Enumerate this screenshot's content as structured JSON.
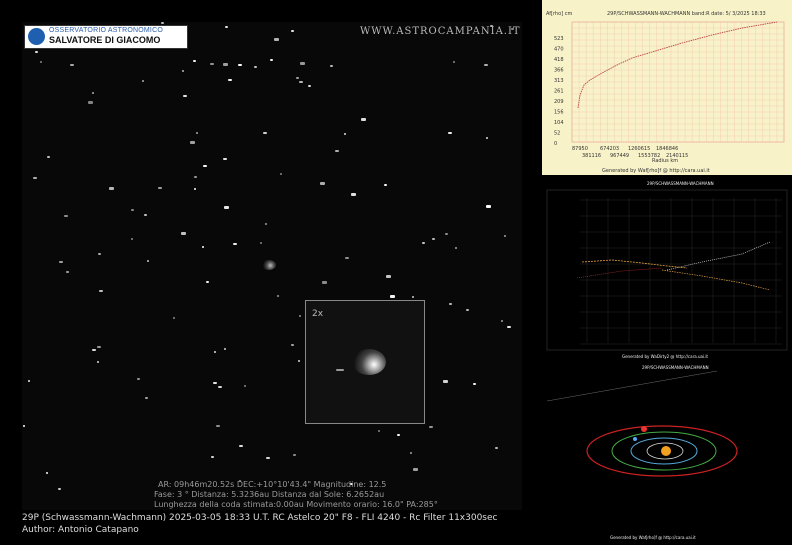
{
  "logo": {
    "line1": "OSSERVATORIO ASTRONOMICO",
    "line2": "SALVATORE DI GIACOMO"
  },
  "website": "WWW.ASTROCAMPANIA.IT",
  "inset": {
    "label": "2x"
  },
  "info": {
    "line1": "AR: 09h46m20.52s DEC:+10°10'43.4\" Magnitudine: 12.5",
    "line2": "Fase: 3 ° Distanza: 5.3236au  Distanza dal Sole: 6.2652au",
    "line3": "Lunghezza della coda stimata:0.00au   Movimento orario: 16.0\" PA:285°"
  },
  "caption": "29P (Schwassmann-Wachmann)  2025-03-05  18:33 U.T.  RC Astelco 20\" F8 - FLI 4240 - Rc Filter 11x300sec",
  "author": "Author: Antonio Catapano",
  "chart": {
    "title": "29P/SCHWASSMANN-WACHMANN band:R date:  5/ 3/2025 18:33",
    "ylabel": "Af[rho] cm",
    "xlabel": "Radius km",
    "footer": "Generated by Waf[rho]f @ http://cara.uai.it",
    "yticks": [
      "523",
      "470",
      "418",
      "366",
      "313",
      "261",
      "209",
      "156",
      "104",
      "52",
      "0"
    ],
    "xticks_top": [
      "87950",
      "674203",
      "1260615",
      "1846846"
    ],
    "xticks_bottom": [
      "381116",
      "967449",
      "1553782",
      "2140115"
    ]
  },
  "panel2": {
    "title": "29P/SCHWASSMANN-WACHMANN",
    "footer": "Generated by WaDirty2 @ http://cara.uai.it"
  },
  "panel3": {
    "title": "29P/SCHWASSMANN-WACHMANN",
    "footer": "Generated by Wafjrho]f @ http://cara.uai.it"
  }
}
